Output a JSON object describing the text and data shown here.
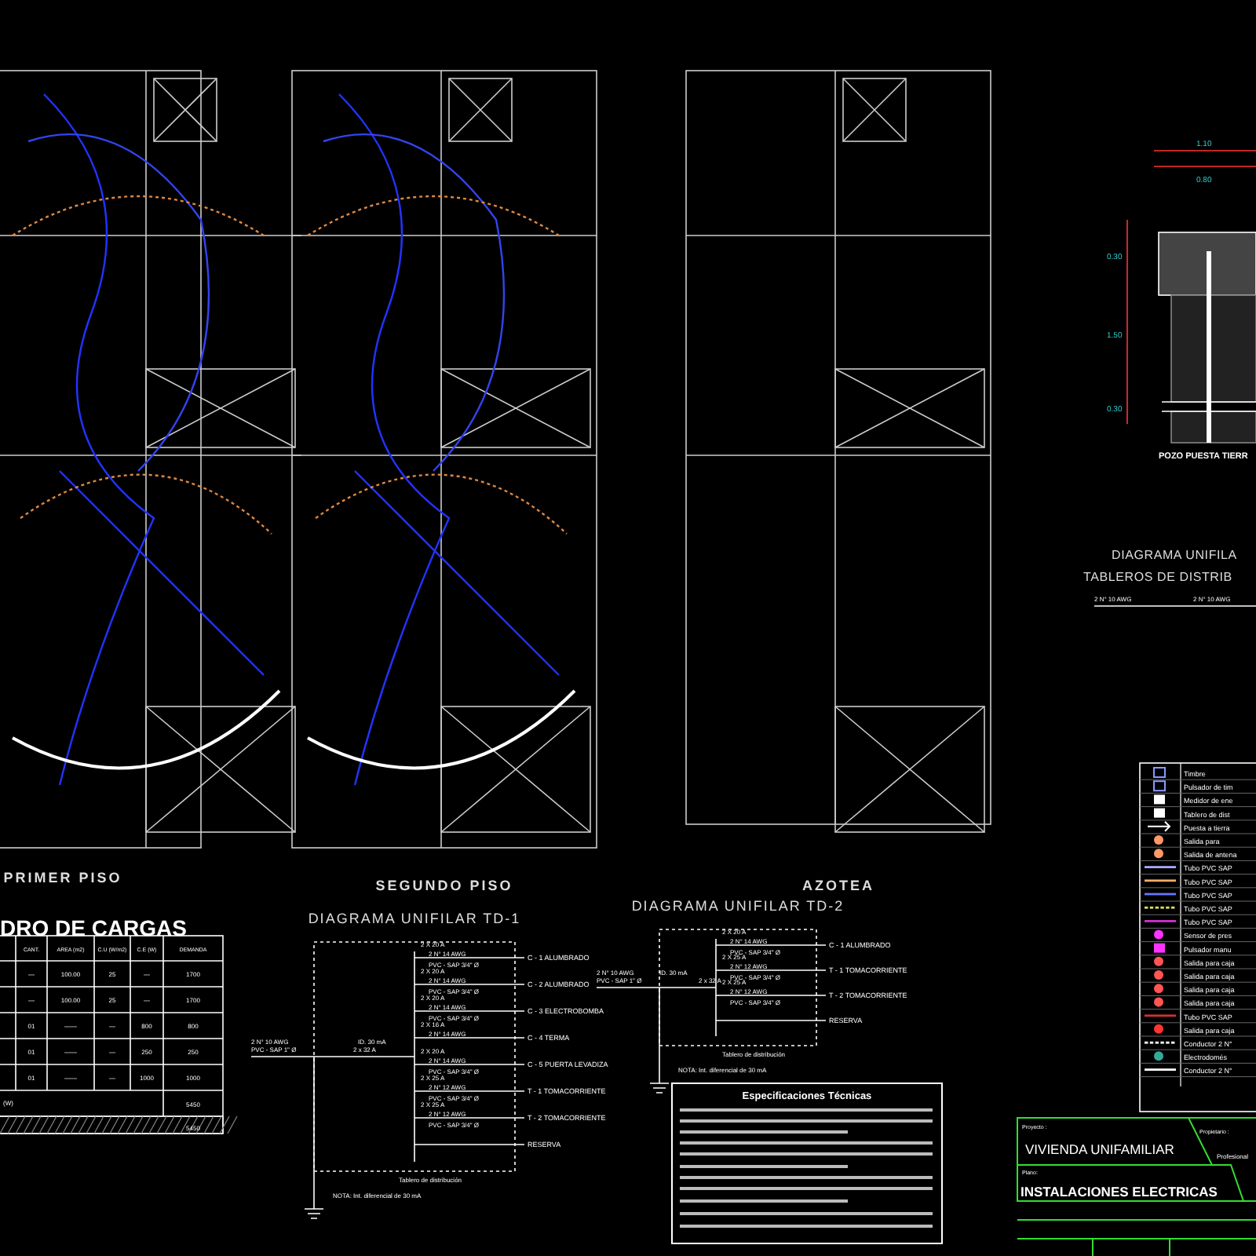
{
  "plans": [
    {
      "title": "PRIMER PISO",
      "kind": "first"
    },
    {
      "title": "SEGUNDO PISO",
      "kind": "second"
    },
    {
      "title": "AZOTEA",
      "kind": "roof"
    }
  ],
  "load_table": {
    "title": "DRO DE CARGAS",
    "columns": [
      "CANT.",
      "AREA (m2)",
      "C.U (W/m2)",
      "C.E (W)",
      "DEMANDA"
    ],
    "rows": [
      [
        "—",
        "100.00",
        "25",
        "—",
        "1700"
      ],
      [
        "—",
        "100.00",
        "25",
        "—",
        "1700"
      ],
      [
        "01",
        "——",
        "—",
        "800",
        "800"
      ],
      [
        "01",
        "——",
        "—",
        "250",
        "250"
      ],
      [
        "01",
        "——",
        "—",
        "1000",
        "1000"
      ]
    ],
    "totals": [
      "5450",
      "5450"
    ],
    "footer_row_label": "(W)"
  },
  "td1": {
    "title": "DIAGRAMA UNIFILAR TD-1",
    "feeder": "2 N° 10 AWG",
    "feeder_pipe": "PVC - SAP 1\" Ø",
    "main_breaker": "2 x 32 A",
    "differential": "ID. 30 mA",
    "board_label": "Tablero de distribución",
    "note": "NOTA: Int. diferencial de 30 mA",
    "circuits": [
      {
        "breaker": "2 X 20 A",
        "cable": "2 N° 14 AWG",
        "pipe": "PVC - SAP 3/4\" Ø",
        "label": "C - 1 ALUMBRADO"
      },
      {
        "breaker": "2 X 20 A",
        "cable": "2 N° 14 AWG",
        "pipe": "PVC - SAP 3/4\" Ø",
        "label": "C - 2 ALUMBRADO"
      },
      {
        "breaker": "2 X 20 A",
        "cable": "2 N° 14 AWG",
        "pipe": "PVC - SAP 3/4\" Ø",
        "label": "C - 3 ELECTROBOMBA"
      },
      {
        "breaker": "2 X 16 A",
        "cable": "2 N° 14 AWG",
        "label": "C - 4 TERMA"
      },
      {
        "breaker": "2 X 20 A",
        "cable": "2 N° 14 AWG",
        "pipe": "PVC - SAP 3/4\" Ø",
        "label": "C - 5 PUERTA LEVADIZA"
      },
      {
        "breaker": "2 X 25 A",
        "cable": "2 N° 12 AWG",
        "pipe": "PVC - SAP 3/4\" Ø",
        "label": "T - 1 TOMACORRIENTE"
      },
      {
        "breaker": "2 X 25 A",
        "cable": "2 N° 12 AWG",
        "pipe": "PVC - SAP 3/4\" Ø",
        "label": "T - 2 TOMACORRIENTE"
      },
      {
        "label": "RESERVA"
      }
    ]
  },
  "td2": {
    "title": "DIAGRAMA UNIFILAR TD-2",
    "feeder": "2 N° 10 AWG",
    "feeder_pipe": "PVC - SAP 1\" Ø",
    "main_breaker": "2 x 32 A",
    "differential": "ID. 30 mA",
    "board_label": "Tablero de distribución",
    "note": "NOTA: Int. diferencial de 30 mA",
    "circuits": [
      {
        "breaker": "2 X 20 A",
        "cable": "2 N° 14 AWG",
        "pipe": "PVC - SAP 3/4\" Ø",
        "label": "C - 1 ALUMBRADO"
      },
      {
        "breaker": "2 X 25 A",
        "cable": "2 N° 12 AWG",
        "pipe": "PVC - SAP 3/4\" Ø",
        "label": "T - 1 TOMACORRIENTE"
      },
      {
        "breaker": "2 X 25 A",
        "cable": "2 N° 12 AWG",
        "pipe": "PVC - SAP 3/4\" Ø",
        "label": "T - 2 TOMACORRIENTE"
      },
      {
        "label": "RESERVA"
      }
    ]
  },
  "specs": {
    "title": "Especificaciones Técnicas"
  },
  "ground_well": {
    "title": "POZO PUESTA TIERR",
    "dims": [
      "1.10",
      "0.80",
      "0.30",
      "1.50",
      "0.30"
    ]
  },
  "boards_diagram": {
    "title_1": "DIAGRAMA UNIFILA",
    "title_2": "TABLEROS DE DISTRIB",
    "feeder_1": "2 N° 10 AWG",
    "feeder_2": "2 N° 10 AWG"
  },
  "legend": [
    {
      "label": "Timbre",
      "kind": "box",
      "color": "#8899ff"
    },
    {
      "label": "Pulsador de tim",
      "kind": "box",
      "color": "#8899ff"
    },
    {
      "label": "Medidor de ene",
      "kind": "fill",
      "color": "#ffffff"
    },
    {
      "label": "Tablero de dist",
      "kind": "fill",
      "color": "#ffffff"
    },
    {
      "label": "Puesta a tierra",
      "kind": "arrow",
      "color": "#ffffff"
    },
    {
      "label": "Salida para",
      "kind": "dot",
      "color": "#ff9966"
    },
    {
      "label": "Salida de antena",
      "kind": "dot",
      "color": "#ff9966"
    },
    {
      "label": "Tubo PVC SAP",
      "kind": "line",
      "color": "#aaaaff"
    },
    {
      "label": "Tubo PVC SAP",
      "kind": "line",
      "color": "#ffaa66"
    },
    {
      "label": "Tubo PVC SAP",
      "kind": "line",
      "color": "#6677ff"
    },
    {
      "label": "Tubo PVC SAP",
      "kind": "dash",
      "color": "#dddd66"
    },
    {
      "label": "Tubo PVC SAP",
      "kind": "line",
      "color": "#cc33cc"
    },
    {
      "label": "Sensor de pres",
      "kind": "dot",
      "color": "#ff33ff"
    },
    {
      "label": "Pulsador manu",
      "kind": "fill",
      "color": "#ff33ff"
    },
    {
      "label": "Salida para caja",
      "kind": "dot",
      "color": "#ff5555"
    },
    {
      "label": "Salida para caja",
      "kind": "dot",
      "color": "#ff5555"
    },
    {
      "label": "Salida para caja",
      "kind": "dot",
      "color": "#ff5555"
    },
    {
      "label": "Salida para caja",
      "kind": "dot",
      "color": "#ff5555"
    },
    {
      "label": "Tubo PVC SAP",
      "kind": "line",
      "color": "#cc3333"
    },
    {
      "label": "Salida para caja",
      "kind": "dot",
      "color": "#ff3333"
    },
    {
      "label": "Conductor 2 N°",
      "kind": "dash",
      "color": "#ffffff"
    },
    {
      "label": "Electrodomés",
      "kind": "dot",
      "color": "#33aa99"
    },
    {
      "label": "Conductor 2 N°",
      "kind": "line",
      "color": "#ffffff"
    }
  ],
  "title_block": {
    "project_label": "Proyecto :",
    "project": "VIVIENDA UNIFAMILIAR",
    "owner_label": "Propietario :",
    "plan_label": "Plano:",
    "plan": "INSTALACIONES ELECTRICAS",
    "professional_label": "Profesional"
  }
}
